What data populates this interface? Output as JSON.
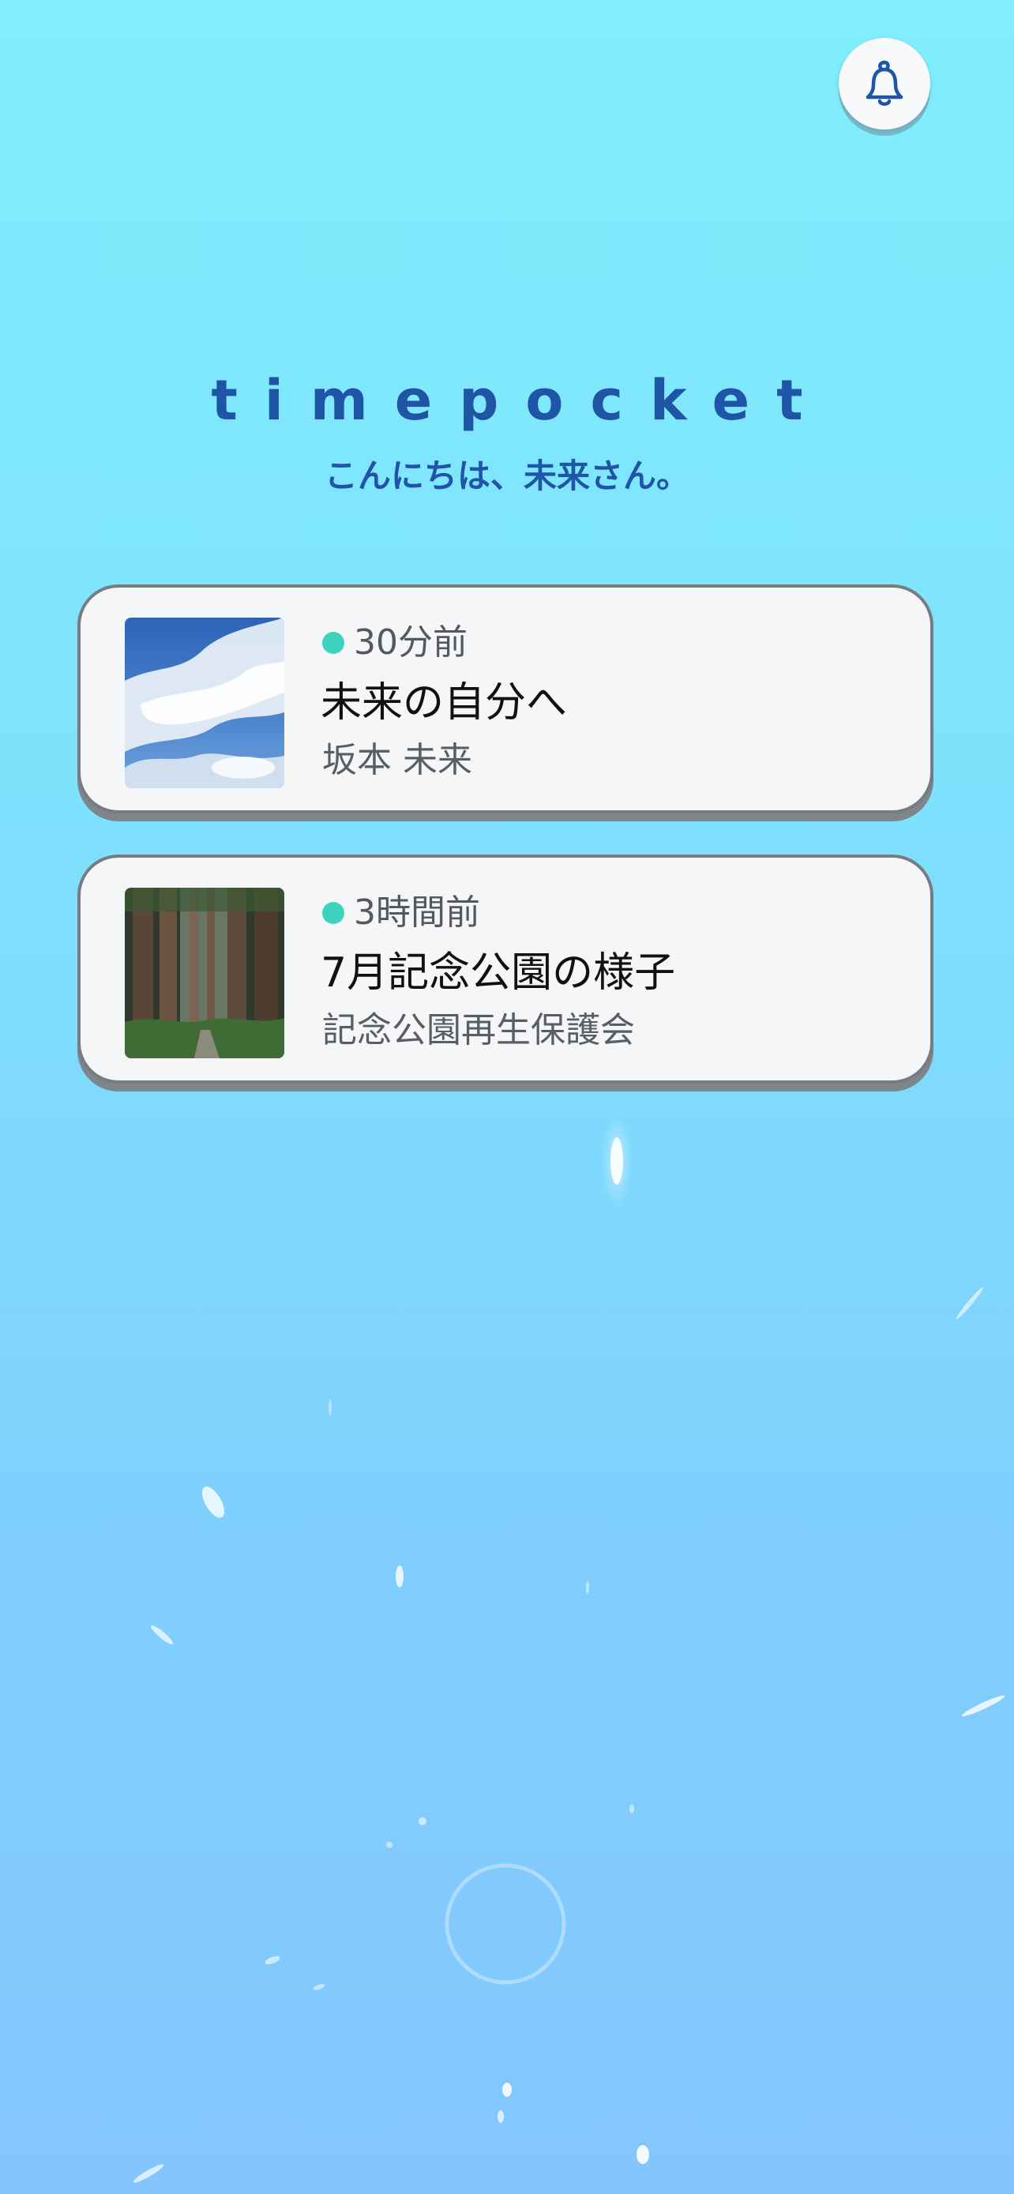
{
  "app": {
    "logo_text": "timepocket",
    "greeting": "こんにちは、未来さん。"
  },
  "header": {
    "notification_icon": "bell-icon"
  },
  "messages": [
    {
      "time": "30分前",
      "title": "未来の自分へ",
      "sender": "坂本 未来",
      "thumbnail": "sky-clouds-photo",
      "status_color": "#3ED3BF"
    },
    {
      "time": "3時間前",
      "title": "7月記念公園の様子",
      "sender": "記念公園再生保護会",
      "thumbnail": "forest-path-photo",
      "status_color": "#3ED3BF"
    }
  ],
  "colors": {
    "accent_text": "#1F55A6",
    "status_dot": "#3ED3BF",
    "card_background": "#F4F6F8"
  }
}
